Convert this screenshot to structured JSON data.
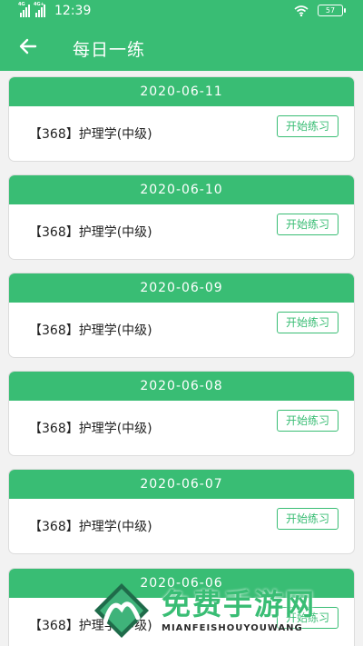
{
  "status": {
    "signal1_label": "4G",
    "signal2_label": "4G+",
    "time": "12:39",
    "battery": "57"
  },
  "header": {
    "title": "每日一练"
  },
  "items": [
    {
      "date": "2020-06-11",
      "name": "【368】护理学(中级)",
      "button": "开始练习"
    },
    {
      "date": "2020-06-10",
      "name": "【368】护理学(中级)",
      "button": "开始练习"
    },
    {
      "date": "2020-06-09",
      "name": "【368】护理学(中级)",
      "button": "开始练习"
    },
    {
      "date": "2020-06-08",
      "name": "【368】护理学(中级)",
      "button": "开始练习"
    },
    {
      "date": "2020-06-07",
      "name": "【368】护理学(中级)",
      "button": "开始练习"
    },
    {
      "date": "2020-06-06",
      "name": "【368】护理学(中级)",
      "button": "开始练习"
    }
  ],
  "watermark": {
    "text_cn": "免费手游网",
    "text_en": "MIANFEISHOUYOUWANG"
  },
  "colors": {
    "accent": "#39bd74",
    "background": "#f2f2f2"
  }
}
